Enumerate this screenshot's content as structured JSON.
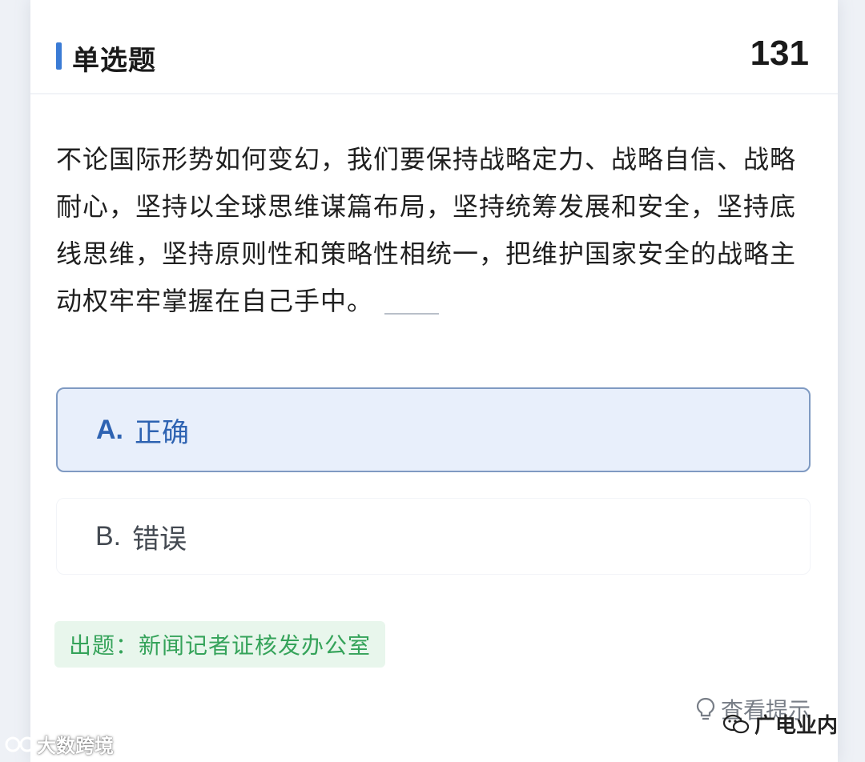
{
  "header": {
    "question_type": "单选题",
    "question_number": "131"
  },
  "question": {
    "text": "不论国际形势如何变幻，我们要保持战略定力、战略自信、战略耐心，坚持以全球思维谋篇布局，坚持统筹发展和安全，坚持底线思维，坚持原则性和策略性相统一，把维护国家安全的战略主动权牢牢掌握在自己手中。"
  },
  "options": [
    {
      "letter": "A.",
      "label": "正确",
      "selected": true
    },
    {
      "letter": "B.",
      "label": "错误",
      "selected": false
    }
  ],
  "source": {
    "text": "出题：新闻记者证核发办公室"
  },
  "hint": {
    "label": "查看提示",
    "icon": "lightbulb-icon"
  },
  "watermarks": {
    "left": "大数跨境",
    "right": "广电业内"
  },
  "colors": {
    "accent": "#3a7bd5",
    "selected_bg": "#e8effb",
    "selected_border": "#7f9ac2",
    "selected_text": "#2e63b2",
    "source_bg": "#e8f6ec",
    "source_text": "#35a35a"
  }
}
